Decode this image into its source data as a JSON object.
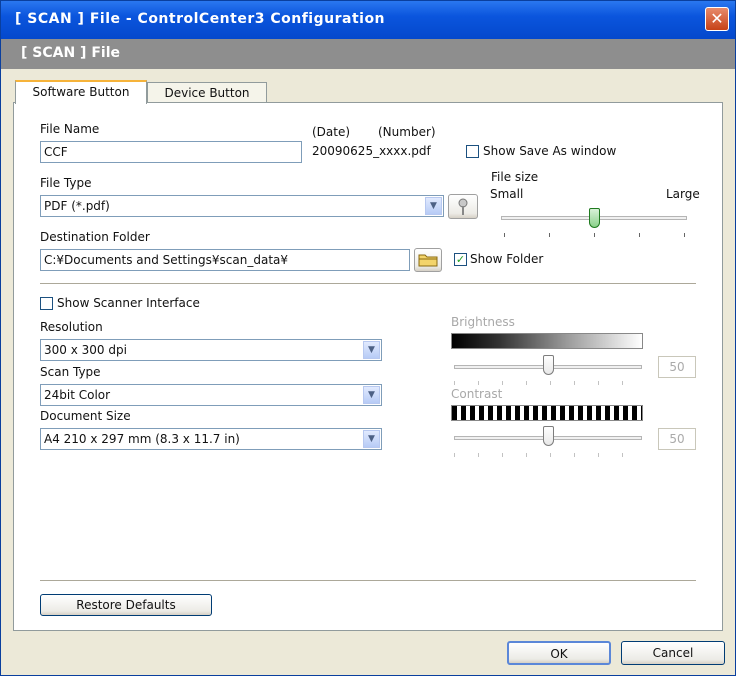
{
  "window": {
    "title": "[ SCAN ]  File - ControlCenter3 Configuration",
    "close_glyph": "✕"
  },
  "banner": {
    "title": "[ SCAN ]   File"
  },
  "tabs": [
    {
      "label": "Software Button",
      "active": true
    },
    {
      "label": "Device Button",
      "active": false
    }
  ],
  "file_name": {
    "label": "File Name",
    "value": "CCF"
  },
  "date_label": "(Date)",
  "number_label": "(Number)",
  "file_suffix": "20090625_xxxx.pdf",
  "show_save_as": {
    "label": "Show Save As window",
    "checked": false
  },
  "file_type": {
    "label": "File Type",
    "value": "PDF (*.pdf)"
  },
  "file_size": {
    "label": "File size",
    "small": "Small",
    "large": "Large"
  },
  "destination": {
    "label": "Destination Folder",
    "value": "C:¥Documents and Settings¥scan_data¥"
  },
  "show_folder": {
    "label": "Show Folder",
    "checked": true,
    "check_glyph": "✓"
  },
  "show_scanner_interface": {
    "label": "Show Scanner Interface",
    "checked": false
  },
  "resolution": {
    "label": "Resolution",
    "value": "300 x 300 dpi"
  },
  "scan_type": {
    "label": "Scan Type",
    "value": "24bit Color"
  },
  "document_size": {
    "label": "Document Size",
    "value": "A4 210 x 297 mm (8.3 x 11.7 in)"
  },
  "brightness": {
    "label": "Brightness",
    "value": "50"
  },
  "contrast": {
    "label": "Contrast",
    "value": "50"
  },
  "restore_defaults": "Restore Defaults",
  "ok": "OK",
  "cancel": "Cancel",
  "icons": {
    "dropdown": "▼",
    "folder": "folder-icon",
    "settings": "pin-icon"
  },
  "colors": {
    "titlebar": "#0b55dd",
    "banner": "#8e8e8e",
    "dialog_bg": "#ece9d8",
    "tab_highlight": "#f6b33a"
  }
}
